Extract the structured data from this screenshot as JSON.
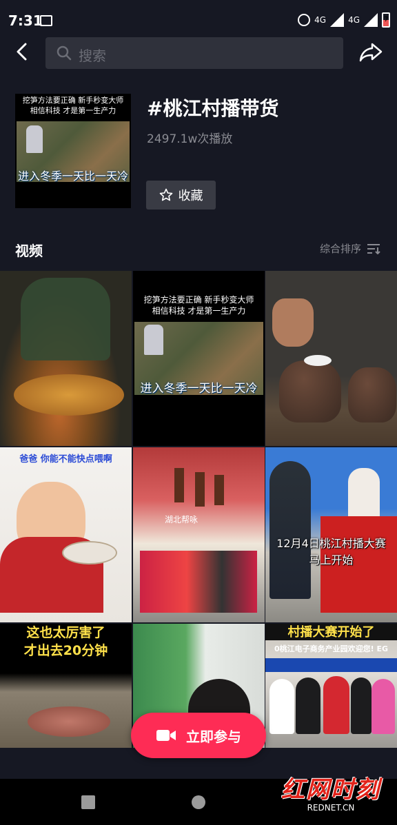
{
  "status_bar": {
    "time": "7:31",
    "network1": "4G",
    "network2": "4G",
    "battery": "7"
  },
  "search": {
    "placeholder": "搜索"
  },
  "topic": {
    "title": "#桃江村播带货",
    "play_count": "2497.1w次播放",
    "favorite_label": "收藏",
    "cover": {
      "caption_top": "挖笋方法要正确  新手秒变大师\n相信科技 才是第一生产力",
      "caption_bottom": "进入冬季一天比一天冷"
    }
  },
  "videos_section": {
    "title": "视频",
    "sort_label": "综合排序"
  },
  "videos": [
    {
      "caption_top": "",
      "caption_bottom": ""
    },
    {
      "caption_top": "挖笋方法要正确  新手秒变大师\n相信科技 才是第一生产力",
      "caption_bottom": "进入冬季一天比一天冷"
    },
    {
      "caption_top": "",
      "caption_bottom": ""
    },
    {
      "caption_top": "爸爸 你能不能快点喂啊",
      "caption_bottom": ""
    },
    {
      "caption_top": "湖北帮咏",
      "caption_bottom": ""
    },
    {
      "caption_top": "12月4日桃江村播大赛\n马上开始",
      "caption_bottom": ""
    },
    {
      "caption_top": "这也太厉害了\n才出去20分钟",
      "caption_bottom": ""
    },
    {
      "caption_top": "",
      "caption_bottom": ""
    },
    {
      "caption_top": "村播大赛开始了",
      "caption_bottom": "0桃江电子商务产业园欢迎您! EG"
    }
  ],
  "record_button": {
    "label": "立即参与"
  },
  "watermark": {
    "main": "红网时刻",
    "sub": "REDNET.CN"
  },
  "colors": {
    "background": "#161823",
    "accent": "#fe2c55",
    "card": "#393b44"
  }
}
